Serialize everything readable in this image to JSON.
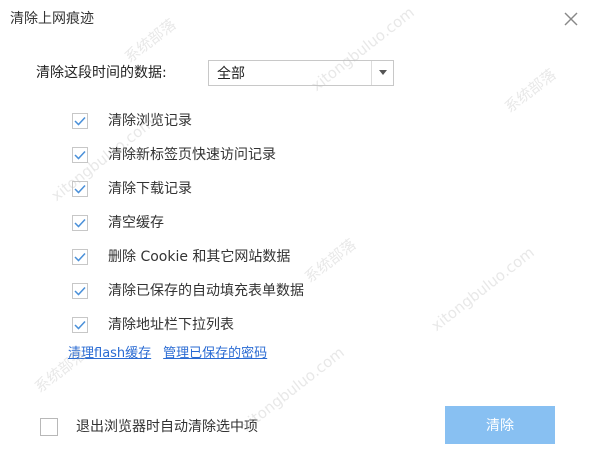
{
  "dialog": {
    "title": "清除上网痕迹",
    "close_icon": "close-icon"
  },
  "time_range": {
    "label": "清除这段时间的数据:",
    "selected": "全部",
    "arrow_icon": "caret-down-icon"
  },
  "options": [
    {
      "label": "清除浏览记录",
      "checked": true
    },
    {
      "label": "清除新标签页快速访问记录",
      "checked": true
    },
    {
      "label": "清除下载记录",
      "checked": true
    },
    {
      "label": "清空缓存",
      "checked": true
    },
    {
      "label": "删除 Cookie 和其它网站数据",
      "checked": true
    },
    {
      "label": "清除已保存的自动填充表单数据",
      "checked": true
    },
    {
      "label": "清除地址栏下拉列表",
      "checked": true
    }
  ],
  "links": {
    "clear_flash": "清理flash缓存",
    "manage_passwords": "管理已保存的密码"
  },
  "footer": {
    "auto_clear_label": "退出浏览器时自动清除选中项",
    "auto_clear_checked": false,
    "clear_button": "清除"
  },
  "colors": {
    "link": "#2a6bd3",
    "checkmark": "#4a90d9",
    "button_bg": "#88c0f2"
  },
  "watermark": [
    "系统部落",
    "xitongbuluo.com"
  ]
}
